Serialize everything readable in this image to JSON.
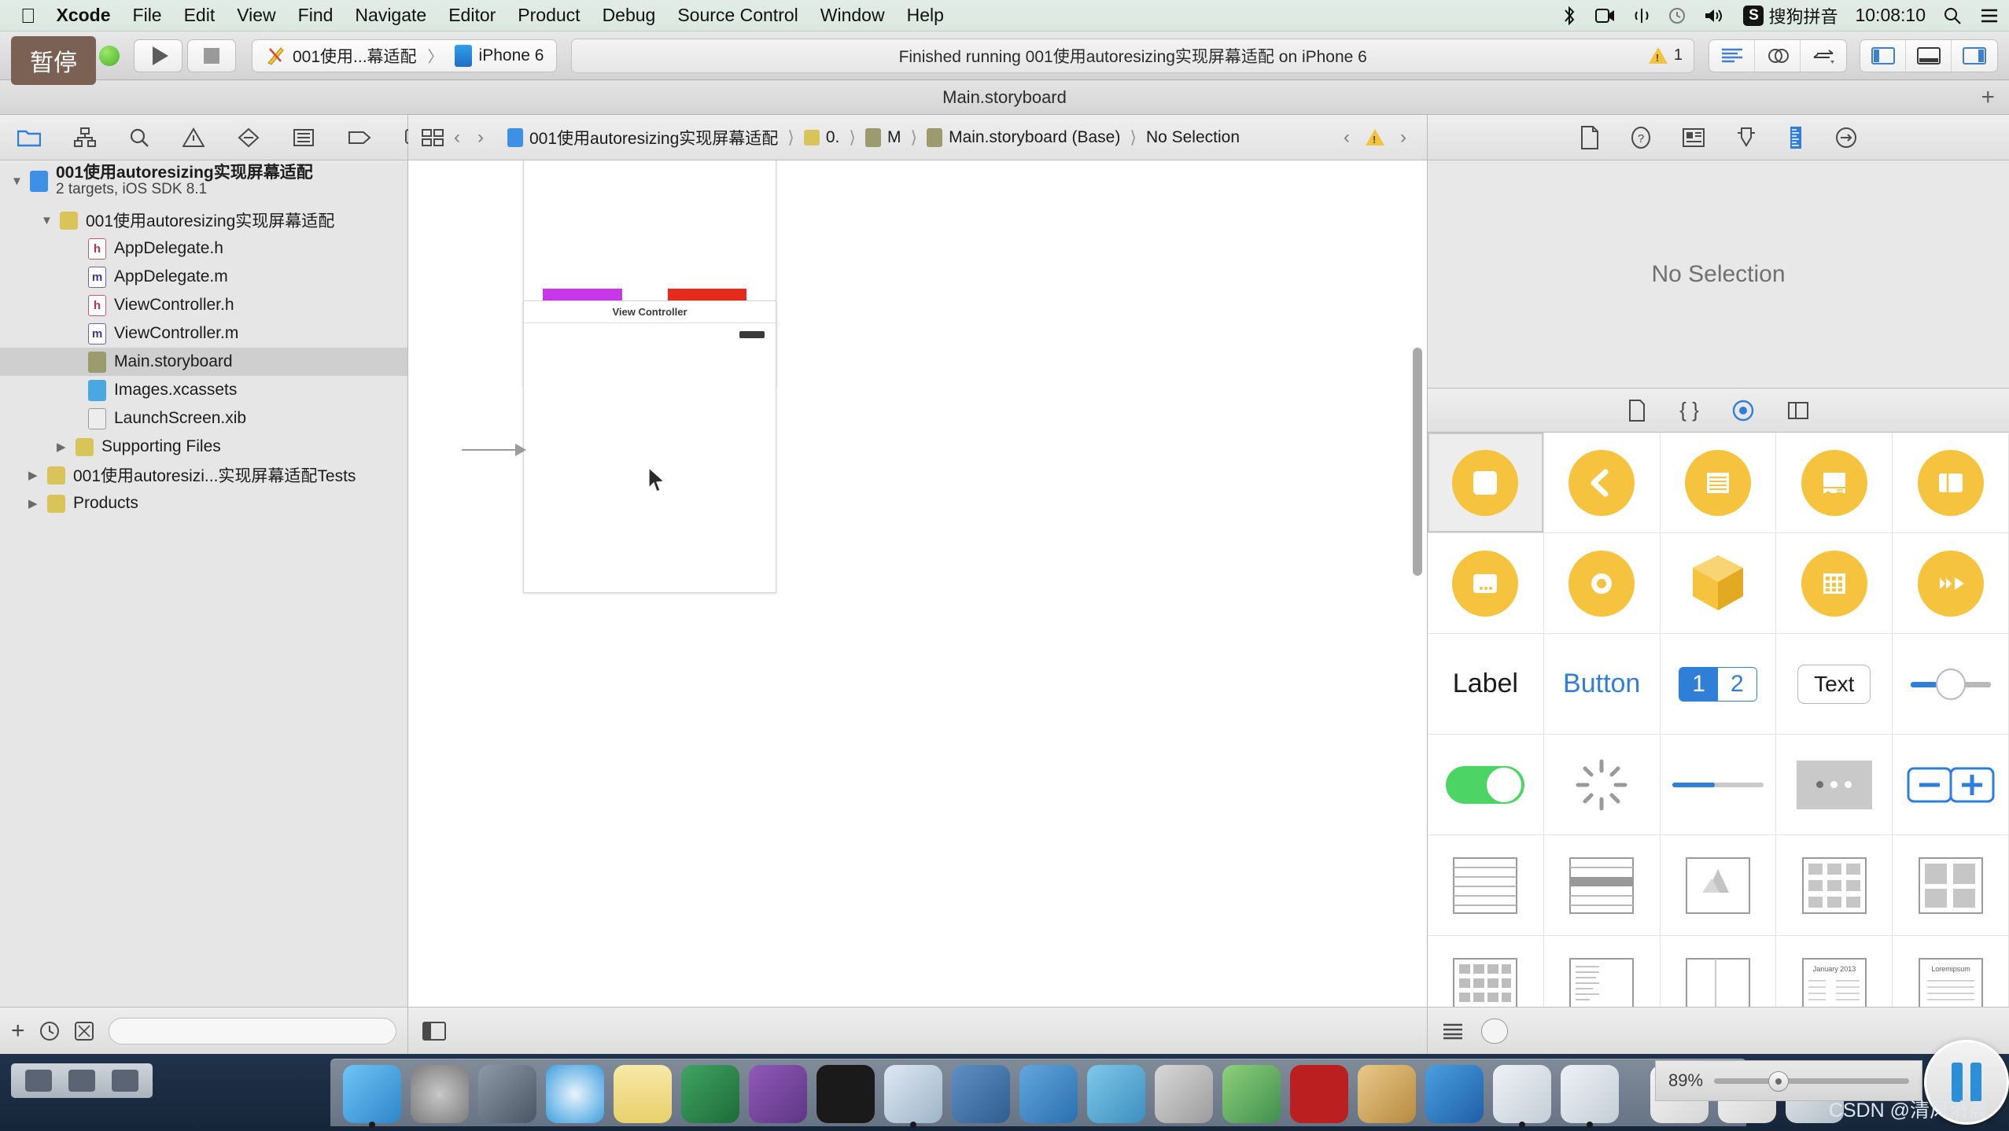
{
  "menubar": {
    "apple_icon": "apple-icon",
    "items": [
      "Xcode",
      "File",
      "Edit",
      "View",
      "Find",
      "Navigate",
      "Editor",
      "Product",
      "Debug",
      "Source Control",
      "Window",
      "Help"
    ],
    "app_name": "Xcode",
    "status_icons": [
      "bluetooth-icon",
      "screen-record-icon",
      "airdrop-icon",
      "timemachine-icon",
      "volume-icon"
    ],
    "input_method_badge": "S",
    "input_method_label": "搜狗拼音",
    "clock": "10:08:10",
    "search_icon": "search-icon",
    "notification_icon": "notification-center-icon"
  },
  "overlay": {
    "pause_label": "暂停"
  },
  "toolbar": {
    "run_icon": "run-play-icon",
    "stop_icon": "stop-square-icon",
    "scheme_name": "001使用...幕适配",
    "scheme_separator": "〉",
    "destination": "iPhone 6",
    "status_text": "Finished running 001使用autoresizing实现屏幕适配 on iPhone 6",
    "warning_count": "1",
    "warning_icon": "warning-triangle-icon",
    "editor_modes": [
      "standard-editor-icon",
      "assistant-editor-icon",
      "version-editor-icon"
    ],
    "view_toggles": [
      "navigator-toggle-icon",
      "debug-area-toggle-icon",
      "utilities-toggle-icon"
    ]
  },
  "titlebar": {
    "title": "Main.storyboard",
    "add_tab_label": "+"
  },
  "navigator": {
    "tabs": [
      "folder-icon",
      "hierarchy-icon",
      "search-icon",
      "warning-icon",
      "breakpoint-icon",
      "report-icon",
      "tag-icon",
      "comment-icon"
    ],
    "tree": [
      {
        "label": "001使用autoresizing实现屏幕适配",
        "sub": "2 targets, iOS SDK 8.1",
        "icon": "project-icon",
        "indent": 0,
        "disclosure": "▼",
        "bold": true,
        "selected": false
      },
      {
        "label": "001使用autoresizing实现屏幕适配",
        "sub": "",
        "icon": "folder-icon",
        "indent": 1,
        "disclosure": "▼",
        "bold": false,
        "selected": false
      },
      {
        "label": "AppDelegate.h",
        "sub": "",
        "icon": "header-file-icon",
        "indent": 2,
        "disclosure": "",
        "bold": false,
        "selected": false
      },
      {
        "label": "AppDelegate.m",
        "sub": "",
        "icon": "implementation-file-icon",
        "indent": 2,
        "disclosure": "",
        "bold": false,
        "selected": false
      },
      {
        "label": "ViewController.h",
        "sub": "",
        "icon": "header-file-icon",
        "indent": 2,
        "disclosure": "",
        "bold": false,
        "selected": false
      },
      {
        "label": "ViewController.m",
        "sub": "",
        "icon": "implementation-file-icon",
        "indent": 2,
        "disclosure": "",
        "bold": false,
        "selected": false
      },
      {
        "label": "Main.storyboard",
        "sub": "",
        "icon": "storyboard-file-icon",
        "indent": 2,
        "disclosure": "",
        "bold": false,
        "selected": true
      },
      {
        "label": "Images.xcassets",
        "sub": "",
        "icon": "assets-catalog-icon",
        "indent": 2,
        "disclosure": "",
        "bold": false,
        "selected": false
      },
      {
        "label": "LaunchScreen.xib",
        "sub": "",
        "icon": "xib-file-icon",
        "indent": 2,
        "disclosure": "",
        "bold": false,
        "selected": false
      },
      {
        "label": "Supporting Files",
        "sub": "",
        "icon": "folder-icon",
        "indent": 2,
        "disclosure": "▶",
        "bold": false,
        "selected": false
      },
      {
        "label": "001使用autoresizi...实现屏幕适配Tests",
        "sub": "",
        "icon": "folder-icon",
        "indent": 1,
        "disclosure": "▶",
        "bold": false,
        "selected": false
      },
      {
        "label": "Products",
        "sub": "",
        "icon": "folder-icon",
        "indent": 1,
        "disclosure": "▶",
        "bold": false,
        "selected": false
      }
    ],
    "bottom": {
      "add_label": "+",
      "recent_icon": "clock-icon",
      "source_control_icon": "source-control-filter-icon",
      "filter_placeholder": ""
    }
  },
  "editor": {
    "jumpbar": {
      "layout_icon": "document-items-icon",
      "back_icon": "chevron-left-icon",
      "forward_icon": "chevron-right-icon",
      "crumbs": [
        "001使用autoresizing实现屏幕适配",
        "0.",
        "M",
        "Main.storyboard (Base)",
        "No Selection"
      ],
      "issue_prev_icon": "chevron-left-icon",
      "issue_icon": "warning-triangle-icon",
      "issue_next_icon": "chevron-right-icon"
    },
    "canvas": {
      "view_controller_title": "View Controller",
      "square_purple_color": "#c938e8",
      "square_red_color": "#e62a1c"
    },
    "bottom": {
      "panel_toggle_icon": "document-outline-toggle-icon"
    }
  },
  "utilities": {
    "inspector_tabs": [
      "file-inspector-icon",
      "quick-help-icon",
      "identity-inspector-icon",
      "attributes-inspector-icon",
      "size-inspector-icon",
      "connections-inspector-icon"
    ],
    "selected_inspector": "size-inspector-icon",
    "no_selection_text": "No Selection",
    "library_tabs": [
      "file-template-library-icon",
      "code-snippet-library-icon",
      "object-library-icon",
      "media-library-icon"
    ],
    "selected_library": "object-library-icon",
    "objects": [
      {
        "name": "view-controller-object",
        "kind": "circle-rounded-rect",
        "label": ""
      },
      {
        "name": "navigation-controller-object",
        "kind": "circle-chevron-left",
        "label": ""
      },
      {
        "name": "table-view-controller-object",
        "kind": "circle-lines",
        "label": ""
      },
      {
        "name": "tab-bar-controller-object",
        "kind": "circle-star",
        "label": ""
      },
      {
        "name": "split-view-controller-object",
        "kind": "circle-split",
        "label": ""
      },
      {
        "name": "page-view-controller-object",
        "kind": "circle-dots",
        "label": ""
      },
      {
        "name": "glkit-view-controller-object",
        "kind": "circle-target",
        "label": ""
      },
      {
        "name": "object-cube",
        "kind": "cube",
        "label": ""
      },
      {
        "name": "collection-view-controller-object",
        "kind": "circle-grid",
        "label": ""
      },
      {
        "name": "avkit-player-controller-object",
        "kind": "circle-play",
        "label": ""
      },
      {
        "name": "label-object",
        "kind": "text",
        "label": "Label"
      },
      {
        "name": "button-object",
        "kind": "text-blue",
        "label": "Button"
      },
      {
        "name": "segmented-control-object",
        "kind": "segmented",
        "label": "1 2"
      },
      {
        "name": "text-field-object",
        "kind": "textfield",
        "label": "Text"
      },
      {
        "name": "slider-object",
        "kind": "slider",
        "label": ""
      },
      {
        "name": "switch-object",
        "kind": "switch",
        "label": ""
      },
      {
        "name": "activity-indicator-object",
        "kind": "spinner",
        "label": ""
      },
      {
        "name": "progress-view-object",
        "kind": "progress",
        "label": ""
      },
      {
        "name": "page-control-object",
        "kind": "pagecontrol",
        "label": ""
      },
      {
        "name": "stepper-object",
        "kind": "stepper",
        "label": ""
      },
      {
        "name": "table-view-object",
        "kind": "table",
        "label": ""
      },
      {
        "name": "table-view-cell-object",
        "kind": "tablecell",
        "label": ""
      },
      {
        "name": "image-view-object",
        "kind": "imageview",
        "label": ""
      },
      {
        "name": "collection-view-object",
        "kind": "collection",
        "label": ""
      },
      {
        "name": "collection-reusable-view-object",
        "kind": "reusable",
        "label": ""
      },
      {
        "name": "collection-view-cell-object",
        "kind": "cvcell",
        "label": ""
      },
      {
        "name": "text-view-object",
        "kind": "textview",
        "label": ""
      },
      {
        "name": "scroll-view-object",
        "kind": "scrollview",
        "label": ""
      },
      {
        "name": "date-picker-object",
        "kind": "datepicker",
        "label": "January  2013"
      },
      {
        "name": "picker-view-object",
        "kind": "pickerview",
        "label": "Loremipsum"
      }
    ],
    "library_filter_placeholder": ""
  },
  "dock": {
    "apps": [
      "finder-icon",
      "system-preferences-icon",
      "launchpad-icon",
      "safari-icon",
      "notes-icon",
      "excel-icon",
      "onenote-icon",
      "terminal-icon",
      "xcode-icon",
      "simulator-icon",
      "keynote-icon",
      "scissors-icon",
      "utility-icon",
      "photo-icon",
      "filezilla-icon",
      "paintbrush-icon",
      "word-icon",
      "preview-icon",
      "preview-icon-2",
      "downloads-icon",
      "documents-icon",
      "trash-icon"
    ],
    "mission_control_icons": [
      "screen-icon",
      "grid-icon",
      "window-icon"
    ]
  },
  "statusbar": {
    "zoom_level": "89%",
    "watermark": "CSDN @清风清晨",
    "pause_button_icon": "pause-icon"
  }
}
